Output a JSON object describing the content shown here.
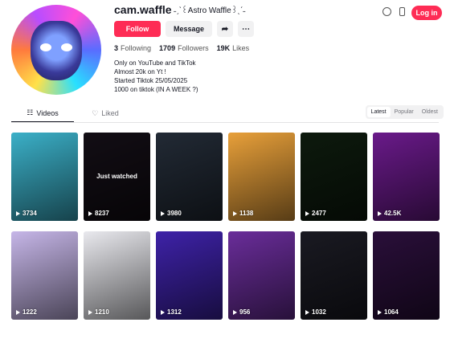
{
  "profile": {
    "username": "cam.waffle",
    "nickname": "˗ˏˋ꒰Astro Waffle꒱ˎˊ˗",
    "follow_label": "Follow",
    "message_label": "Message",
    "login_label": "Log in",
    "stats": [
      {
        "value": "3",
        "label": "Following"
      },
      {
        "value": "1709",
        "label": "Followers"
      },
      {
        "value": "19K",
        "label": "Likes"
      }
    ],
    "bio": [
      "Only on YouTube and TikTok",
      "Almost 20k on Yt !",
      "Started Tiktok 25/05/2025",
      "1000 on tiktok (IN A WEEK ?)"
    ],
    "accent": "#fe2c55"
  },
  "tabs": [
    {
      "label": "Videos",
      "icon": "grid-icon"
    },
    {
      "label": "Liked",
      "icon": "heart-icon"
    }
  ],
  "sort_options": [
    "Latest",
    "Popular",
    "Oldest"
  ],
  "videos": [
    {
      "views": "3734",
      "color": "#3bb0c8",
      "watched": ""
    },
    {
      "views": "8237",
      "color": "#2a1f2e",
      "watched": "Just watched"
    },
    {
      "views": "3980",
      "color": "#222a35",
      "watched": ""
    },
    {
      "views": "1138",
      "color": "#e8a03a",
      "watched": ""
    },
    {
      "views": "2477",
      "color": "#0d1a0d",
      "watched": ""
    },
    {
      "views": "42.5K",
      "color": "#6a1a8a",
      "watched": ""
    },
    {
      "views": "1222",
      "color": "#c6b6e8",
      "watched": ""
    },
    {
      "views": "1210",
      "color": "#e9e9ee",
      "watched": ""
    },
    {
      "views": "1312",
      "color": "#3e22a8",
      "watched": ""
    },
    {
      "views": "956",
      "color": "#6a2d9a",
      "watched": ""
    },
    {
      "views": "1032",
      "color": "#1a1a22",
      "watched": ""
    },
    {
      "views": "1064",
      "color": "#2a0f3a",
      "watched": ""
    }
  ]
}
